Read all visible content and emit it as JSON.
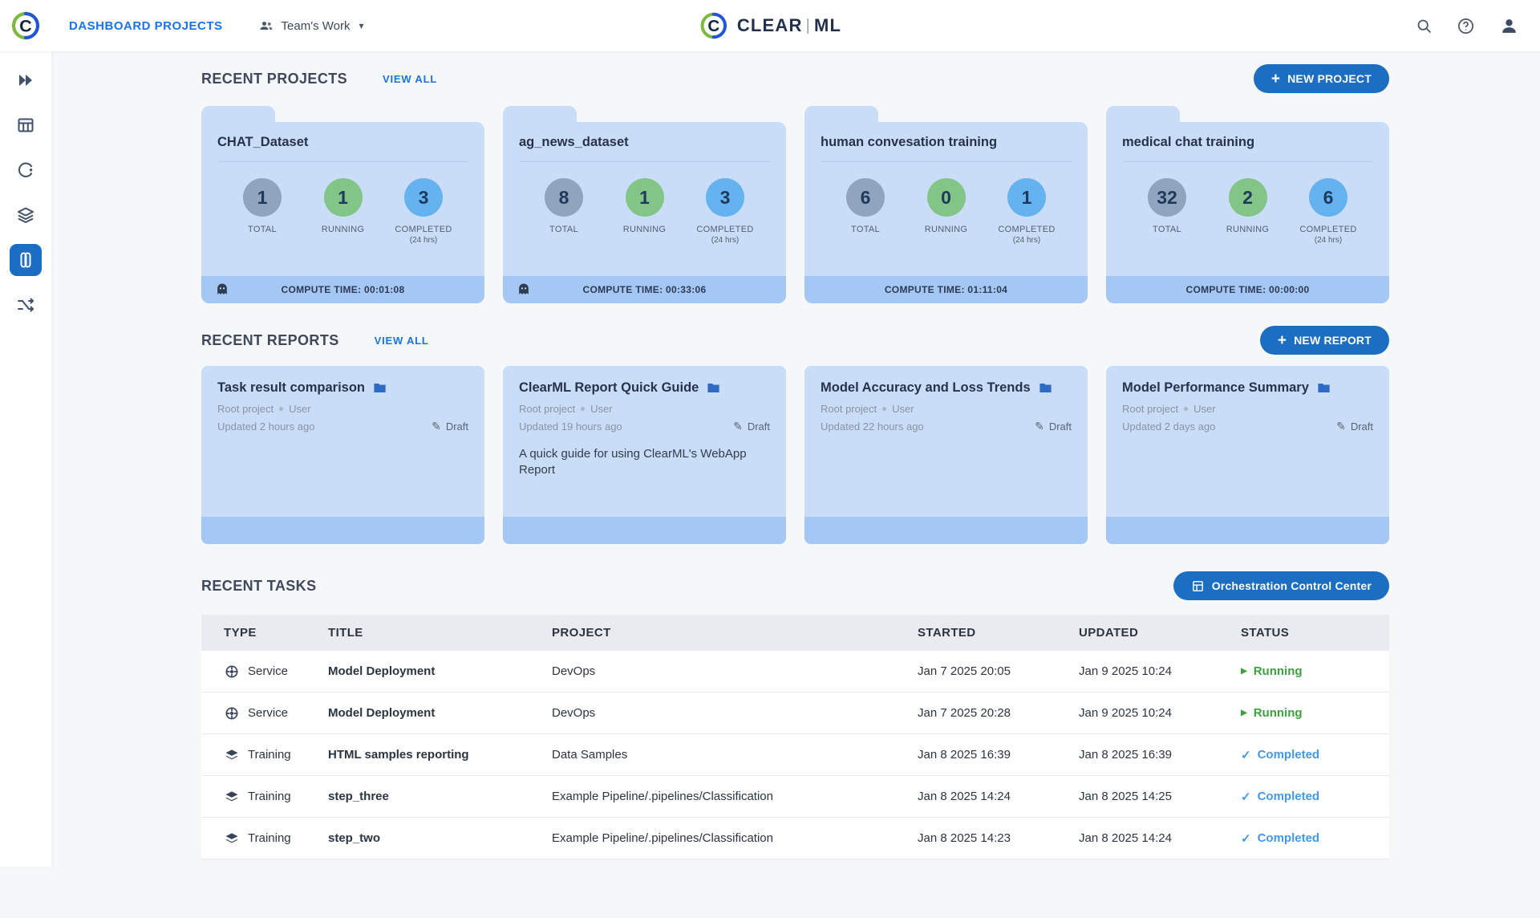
{
  "topbar": {
    "nav_title": "DASHBOARD PROJECTS",
    "workspace_label": "Team's Work",
    "logo_primary": "CLEAR",
    "logo_secondary": "ML"
  },
  "projects_section": {
    "title": "RECENT PROJECTS",
    "view_all": "VIEW ALL",
    "new_button_label": "NEW PROJECT",
    "stat_labels": {
      "total": "TOTAL",
      "running": "RUNNING",
      "completed": "COMPLETED",
      "completed_sub": "(24 hrs)"
    },
    "cards": [
      {
        "name": "CHAT_Dataset",
        "total": "1",
        "running": "1",
        "completed": "3",
        "compute_time": "COMPUTE TIME: 00:01:08",
        "ghost": true
      },
      {
        "name": "ag_news_dataset",
        "total": "8",
        "running": "1",
        "completed": "3",
        "compute_time": "COMPUTE TIME: 00:33:06",
        "ghost": true
      },
      {
        "name": "human convesation training",
        "total": "6",
        "running": "0",
        "completed": "1",
        "compute_time": "COMPUTE TIME: 01:11:04",
        "ghost": false
      },
      {
        "name": "medical chat training",
        "total": "32",
        "running": "2",
        "completed": "6",
        "compute_time": "COMPUTE TIME: 00:00:00",
        "ghost": false
      }
    ]
  },
  "reports_section": {
    "title": "RECENT REPORTS",
    "view_all": "VIEW ALL",
    "new_button_label": "NEW REPORT",
    "cards": [
      {
        "title": "Task result comparison",
        "project": "Root project",
        "user": "User",
        "updated": "Updated 2 hours ago",
        "badge": "Draft",
        "description": ""
      },
      {
        "title": "ClearML Report Quick Guide",
        "project": "Root project",
        "user": "User",
        "updated": "Updated 19 hours ago",
        "badge": "Draft",
        "description": "A quick guide for using ClearML's WebApp Report"
      },
      {
        "title": "Model Accuracy and Loss Trends",
        "project": "Root project",
        "user": "User",
        "updated": "Updated 22 hours ago",
        "badge": "Draft",
        "description": ""
      },
      {
        "title": "Model Performance Summary",
        "project": "Root project",
        "user": "User",
        "updated": "Updated 2 days ago",
        "badge": "Draft",
        "description": ""
      }
    ]
  },
  "tasks_section": {
    "title": "RECENT TASKS",
    "orchestration_button_label": "Orchestration Control Center",
    "headers": {
      "type": "TYPE",
      "title": "TITLE",
      "project": "PROJECT",
      "started": "STARTED",
      "updated": "UPDATED",
      "status": "STATUS"
    },
    "rows": [
      {
        "type": "Service",
        "title": "Model Deployment",
        "project": "DevOps",
        "started": "Jan 7 2025 20:05",
        "updated": "Jan 9 2025 10:24",
        "status": "Running"
      },
      {
        "type": "Service",
        "title": "Model Deployment",
        "project": "DevOps",
        "started": "Jan 7 2025 20:28",
        "updated": "Jan 9 2025 10:24",
        "status": "Running"
      },
      {
        "type": "Training",
        "title": "HTML samples reporting",
        "project": "Data Samples",
        "started": "Jan 8 2025 16:39",
        "updated": "Jan 8 2025 16:39",
        "status": "Completed"
      },
      {
        "type": "Training",
        "title": "step_three",
        "project": "Example Pipeline/.pipelines/Classification",
        "started": "Jan 8 2025 14:24",
        "updated": "Jan 8 2025 14:25",
        "status": "Completed"
      },
      {
        "type": "Training",
        "title": "step_two",
        "project": "Example Pipeline/.pipelines/Classification",
        "started": "Jan 8 2025 14:23",
        "updated": "Jan 8 2025 14:24",
        "status": "Completed"
      }
    ]
  },
  "colors": {
    "accent_blue": "#1a73e8",
    "button_blue": "#1b6ec2",
    "card_blue": "#c9dcf8",
    "strip_blue": "#a5c7f3",
    "total_circle": "#90a5bd",
    "running_circle": "#83c586",
    "completed_circle": "#64b2ef",
    "running_status": "#3da13f",
    "completed_status": "#4398e8"
  }
}
